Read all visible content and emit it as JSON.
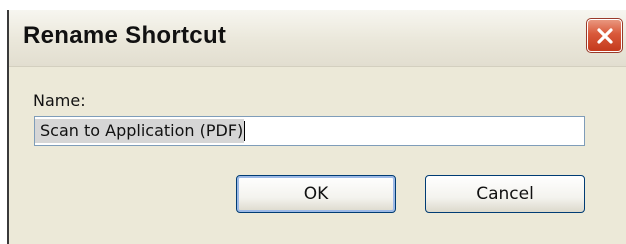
{
  "dialog": {
    "title": "Rename Shortcut",
    "close_icon": "close-x-icon",
    "name_label": "Name:",
    "name_value": "Scan to Application (PDF)",
    "ok_label": "OK",
    "cancel_label": "Cancel"
  },
  "colors": {
    "dialog_background": "#ece9d8",
    "close_button": "#d9593a",
    "focus_ring": "#9cb9e6",
    "input_border": "#7f9db9"
  }
}
